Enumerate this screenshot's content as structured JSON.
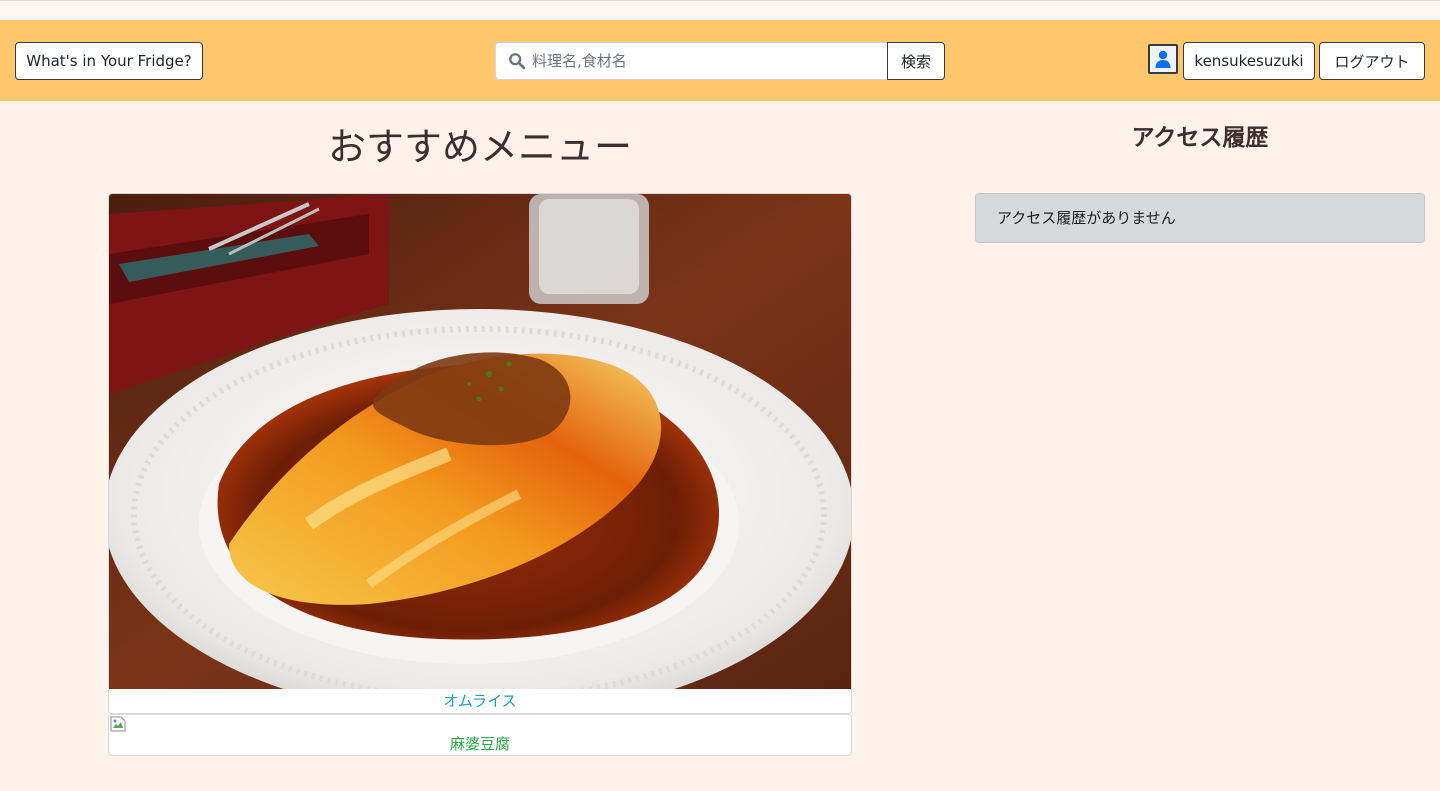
{
  "navbar": {
    "brand_label": "What's in Your Fridge?",
    "search_placeholder": "料理名,食材名",
    "search_button": "検索",
    "username": "kensukesuzuki",
    "logout_label": "ログアウト",
    "background_color": "#ffc76b"
  },
  "main": {
    "title": "おすすめメニュー",
    "recommendations": [
      {
        "label": "オムライス",
        "color": "#17a2b8"
      },
      {
        "label": "麻婆豆腐",
        "color": "#28a745"
      }
    ]
  },
  "sidebar": {
    "title": "アクセス履歴",
    "empty_message": "アクセス履歴がありません"
  },
  "icons": {
    "search": "search-icon",
    "user": "user-icon",
    "broken_image": "broken-image-icon"
  }
}
